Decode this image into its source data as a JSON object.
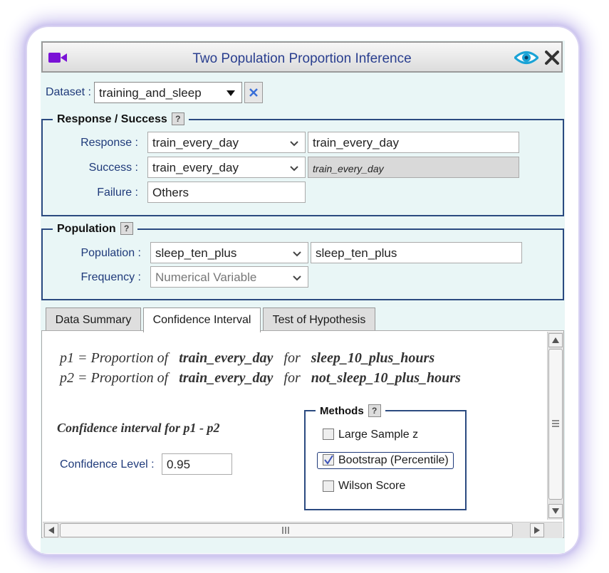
{
  "window": {
    "title": "Two Population Proportion Inference"
  },
  "dataset": {
    "label": "Dataset :",
    "value": "training_and_sleep"
  },
  "response_section": {
    "legend": "Response / Success",
    "help": "?",
    "response_label": "Response :",
    "response_value": "train_every_day",
    "response_text": "train_every_day",
    "success_label": "Success :",
    "success_value": "train_every_day",
    "success_text": "train_every_day",
    "failure_label": "Failure :",
    "failure_value": "Others"
  },
  "population_section": {
    "legend": "Population",
    "help": "?",
    "population_label": "Population :",
    "population_value": "sleep_ten_plus",
    "population_text": "sleep_ten_plus",
    "frequency_label": "Frequency :",
    "frequency_value": "Numerical Variable"
  },
  "tabs": [
    "Data Summary",
    "Confidence Interval",
    "Test of Hypothesis"
  ],
  "active_tab": "Confidence Interval",
  "panel": {
    "p1_prefix": "p1 = Proportion of",
    "p1_var": "train_every_day",
    "p1_for": "for",
    "p1_group": "sleep_10_plus_hours",
    "p2_prefix": "p2 = Proportion of",
    "p2_var": "train_every_day",
    "p2_for": "for",
    "p2_group": "not_sleep_10_plus_hours",
    "ci_heading": "Confidence interval for p1 - p2",
    "conf_label": "Confidence Level :",
    "conf_value": "0.95",
    "methods_legend": "Methods",
    "methods_help": "?",
    "methods": [
      {
        "label": "Large Sample z",
        "checked": false
      },
      {
        "label": "Bootstrap (Percentile)",
        "checked": true
      },
      {
        "label": "Wilson Score",
        "checked": false
      }
    ]
  },
  "colors": {
    "accent": "#2b4a80",
    "title": "#2a3f8f",
    "camera": "#7a12d6",
    "eye": "#1aa3d6"
  }
}
